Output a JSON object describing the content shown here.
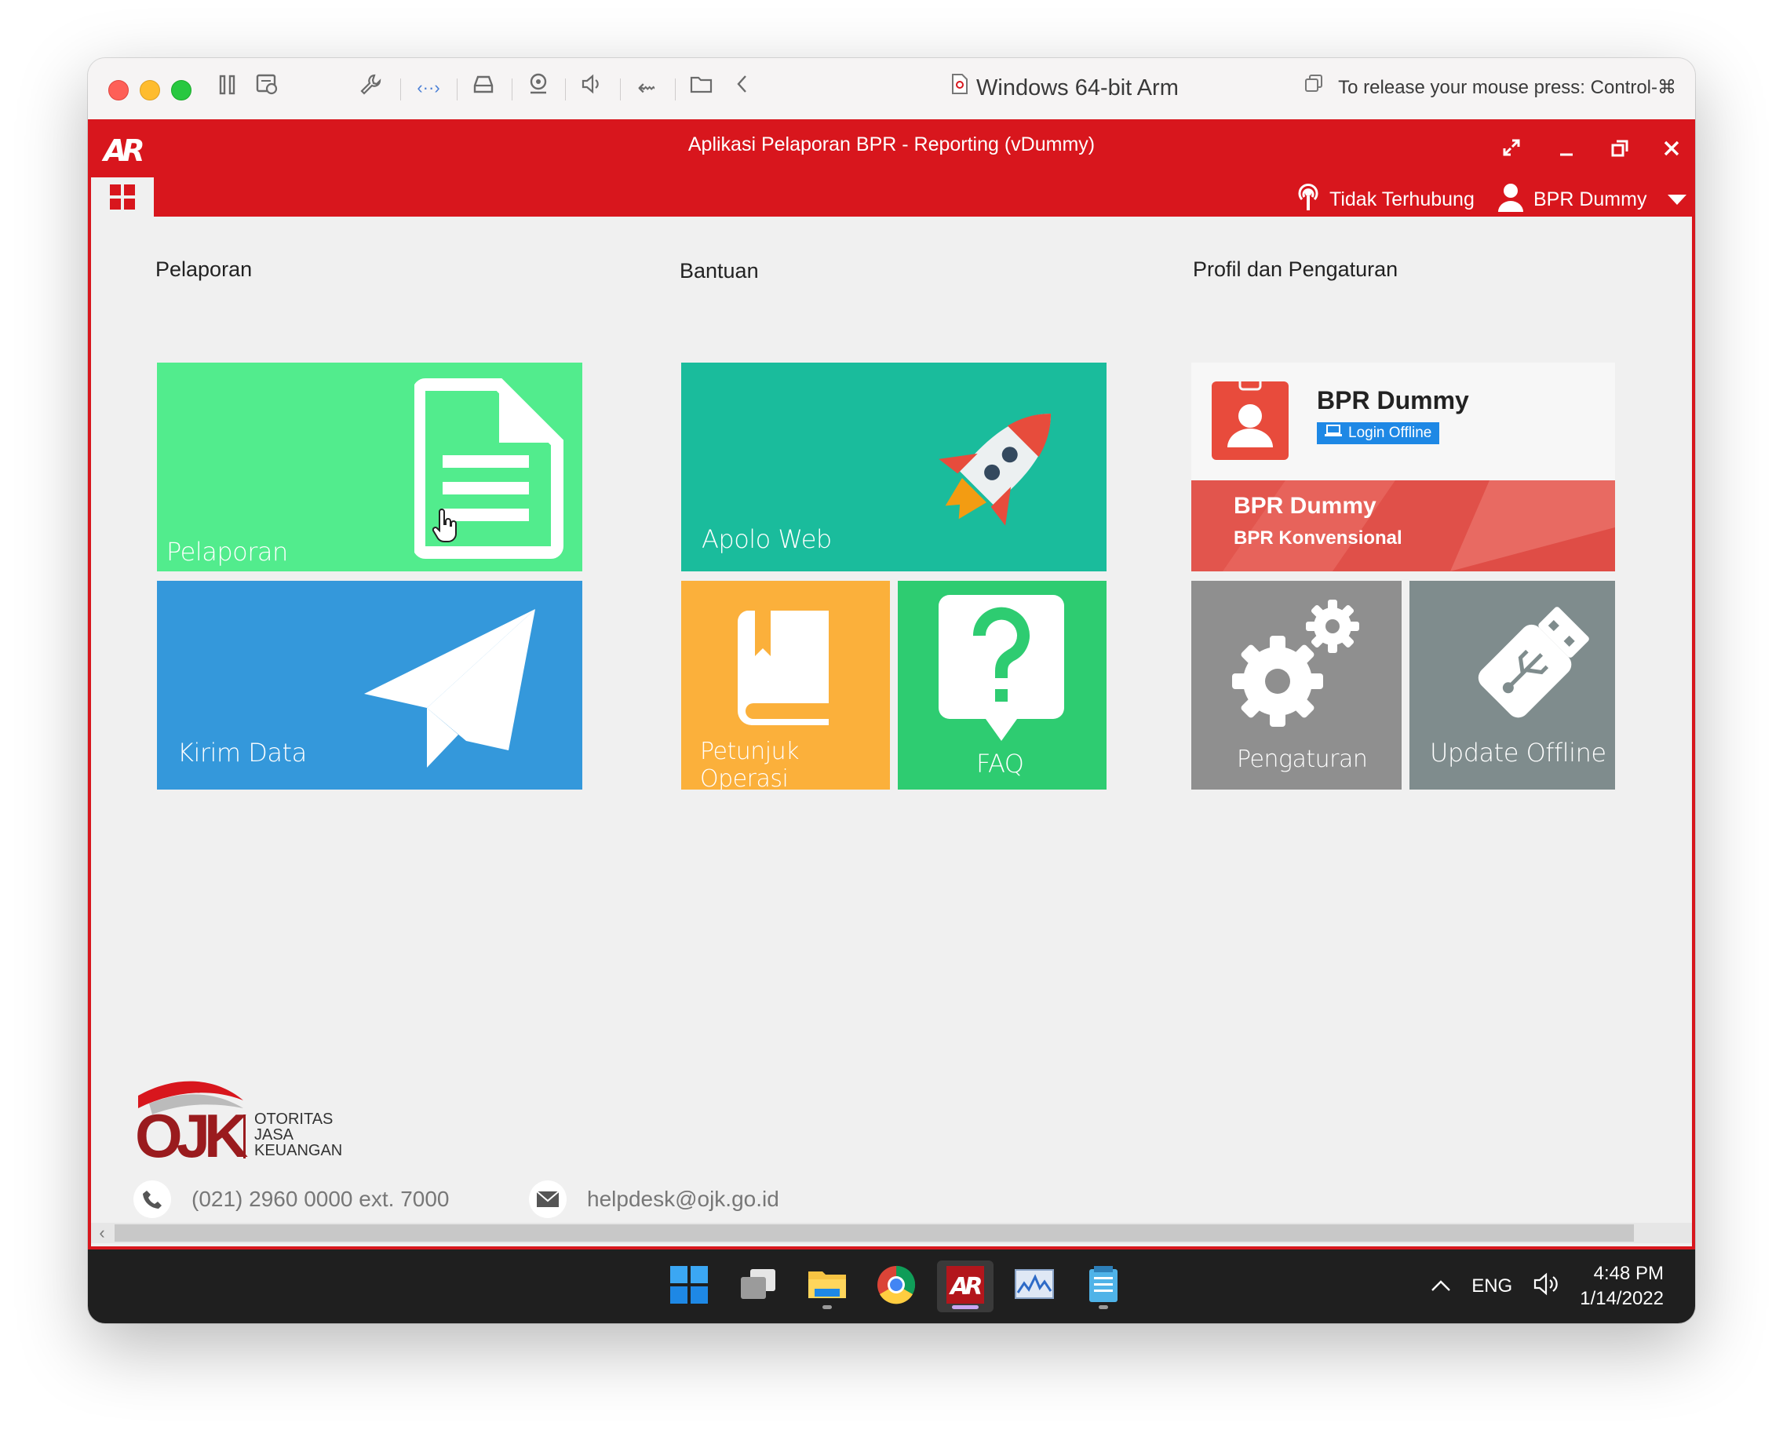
{
  "vm_titlebar": {
    "title": "Windows 64-bit Arm",
    "release_hint": "To release your mouse press: Control-⌘"
  },
  "app": {
    "logo_text": "AR",
    "title": "Aplikasi Pelaporan BPR - Reporting (vDummy)",
    "connection_status": "Tidak Terhubung",
    "user_name": "BPR Dummy"
  },
  "sections": {
    "pelaporan": {
      "title": "Pelaporan",
      "tiles": {
        "pelaporan": "Pelaporan",
        "kirim_data": "Kirim Data"
      }
    },
    "bantuan": {
      "title": "Bantuan",
      "tiles": {
        "apolo_web": "Apolo Web",
        "petunjuk_operasi": "Petunjuk Operasi",
        "faq": "FAQ"
      }
    },
    "profil": {
      "title": "Profil dan Pengaturan",
      "profile_name": "BPR Dummy",
      "login_badge": "Login Offline",
      "banner_name": "BPR Dummy",
      "banner_type": "BPR Konvensional",
      "tiles": {
        "pengaturan": "Pengaturan",
        "update_offline": "Update Offline"
      }
    }
  },
  "footer": {
    "ojk_lines": [
      "OTORITAS",
      "JASA",
      "KEUANGAN"
    ],
    "ojk_mark": "OJK",
    "phone": "(021) 2960 0000 ext. 7000",
    "email": "helpdesk@ojk.go.id"
  },
  "taskbar": {
    "language": "ENG",
    "time": "4:48 PM",
    "date": "1/14/2022"
  },
  "colors": {
    "brand_red": "#d8161d",
    "tile_pelaporan": "#52ec8d",
    "tile_kirim": "#3498db",
    "tile_apolo": "#1abc9c",
    "tile_petunjuk": "#fbb03b",
    "tile_faq": "#2ecc71",
    "tile_pengaturan": "#8f8f8f",
    "tile_update": "#7f8c8d"
  }
}
